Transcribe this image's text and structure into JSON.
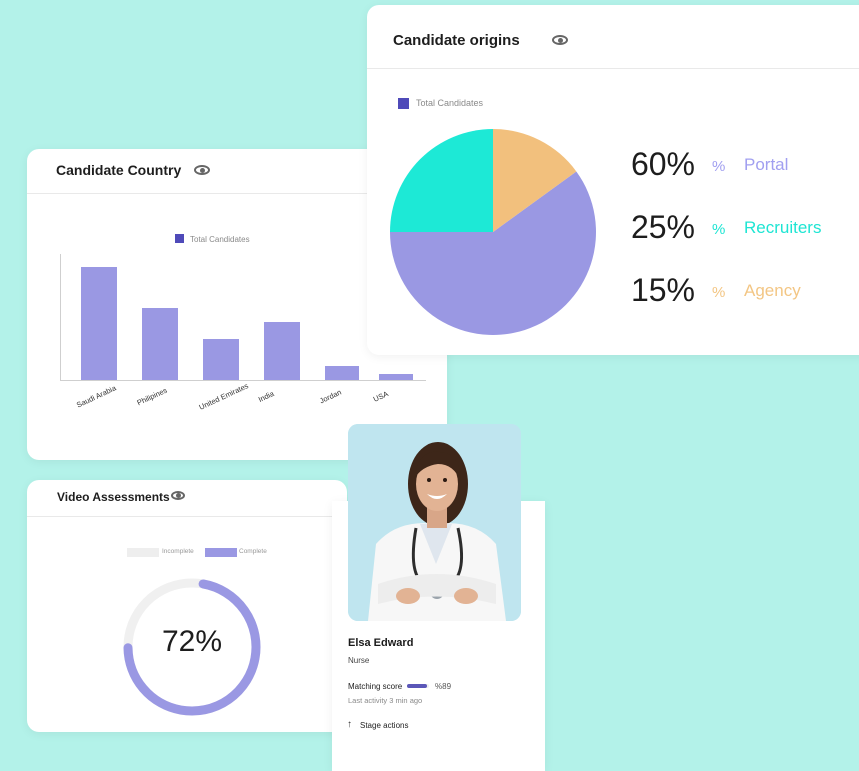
{
  "country_card": {
    "title": "Candidate Country",
    "eye_icon": "eye-icon",
    "legend": "Total Candidates"
  },
  "chart_data": [
    {
      "type": "bar",
      "title": "",
      "legend": [
        "Total Candidates"
      ],
      "categories": [
        "Saudi Arabia",
        "Philipines",
        "United Emirates",
        "India",
        "Jordan",
        "USA"
      ],
      "values": [
        100,
        64,
        36,
        51,
        12,
        5
      ],
      "ylim": [
        0,
        100
      ],
      "color": "#9a98e3"
    },
    {
      "type": "pie",
      "legend": [
        "Total Candidates"
      ],
      "slices": [
        {
          "label": "Portal",
          "value": 60,
          "color": "#9a98e3"
        },
        {
          "label": "Recruiters",
          "value": 25,
          "color": "#1de9d6"
        },
        {
          "label": "Agency",
          "value": 15,
          "color": "#f2c07d"
        }
      ]
    }
  ],
  "origins_card": {
    "title": "Candidate origins",
    "legend": "Total Candidates",
    "rows": [
      {
        "pct": "60%",
        "sign": "%",
        "label": "Portal",
        "color": "#a19ff0"
      },
      {
        "pct": "25%",
        "sign": "%",
        "label": "Recruiters",
        "color": "#1ee5d3"
      },
      {
        "pct": "15%",
        "sign": "%",
        "label": "Agency",
        "color": "#f3c684"
      }
    ]
  },
  "video_card": {
    "title": "Video Assessments",
    "legend_incomplete": "Incomplete",
    "legend_complete": "Complete",
    "percent_text": "72%",
    "progress": 0.72,
    "track_color": "#f0f0f0",
    "fill_color": "#9a98e3"
  },
  "profile_card": {
    "name": "Elsa Edward",
    "role": "Nurse",
    "matching_label": "Matching score",
    "matching_value": "%89",
    "matching_fraction": 0.89,
    "last_activity": "Last activity 3 min ago",
    "stage_actions": "Stage actions",
    "arrow_icon": "arrow-up-icon"
  }
}
